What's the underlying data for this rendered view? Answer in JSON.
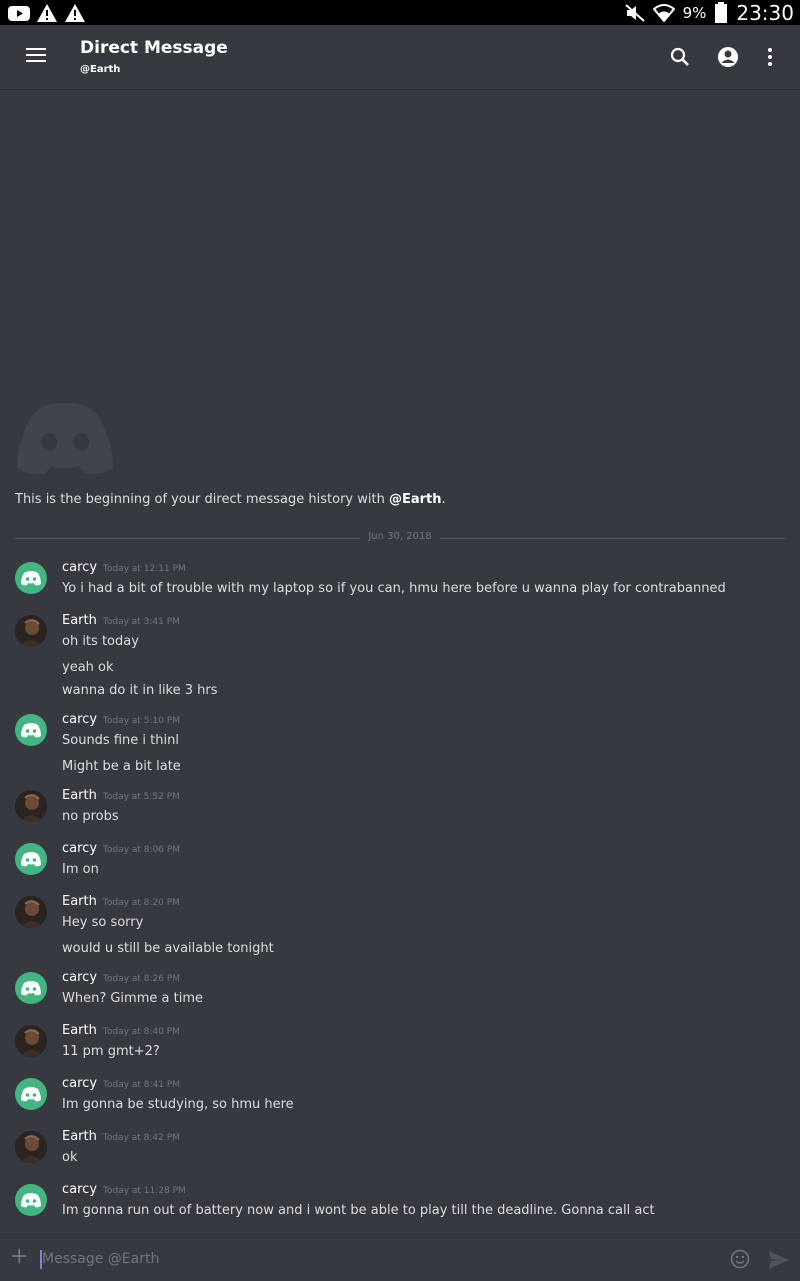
{
  "status_bar": {
    "icons": [
      "youtube-icon",
      "warning-icon",
      "warning-icon",
      "mute-icon",
      "wifi-icon",
      "battery-icon"
    ],
    "battery": "9%",
    "time": "23:30"
  },
  "header": {
    "title": "Direct Message",
    "subtitle": "@Earth",
    "icons": [
      "menu-icon",
      "search-icon",
      "account-icon",
      "more-icon"
    ]
  },
  "welcome": {
    "text_prefix": "This is the beginning of your direct message history with ",
    "mention": "@Earth",
    "text_suffix": "."
  },
  "divider_date": "Jun 30, 2018",
  "messages": [
    {
      "author": "carcy",
      "time": "Today at 12:11 PM",
      "lines": [
        "Yo i had a bit of trouble with my laptop so if you can, hmu here before u wanna play for contrabanned"
      ]
    },
    {
      "author": "Earth",
      "time": "Today at 3:41 PM",
      "lines": [
        "oh its today",
        "yeah ok",
        "wanna do it in like 3 hrs"
      ]
    },
    {
      "author": "carcy",
      "time": "Today at 5:10 PM",
      "lines": [
        "Sounds fine i thinl",
        "Might be a bit late"
      ]
    },
    {
      "author": "Earth",
      "time": "Today at 5:52 PM",
      "lines": [
        "no probs"
      ]
    },
    {
      "author": "carcy",
      "time": "Today at 8:06 PM",
      "lines": [
        "Im on"
      ]
    },
    {
      "author": "Earth",
      "time": "Today at 8:20 PM",
      "lines": [
        "Hey so sorry",
        "would u still be available tonight"
      ]
    },
    {
      "author": "carcy",
      "time": "Today at 8:26 PM",
      "lines": [
        "When? Gimme a time"
      ]
    },
    {
      "author": "Earth",
      "time": "Today at 8:40 PM",
      "lines": [
        "11 pm gmt+2?"
      ]
    },
    {
      "author": "carcy",
      "time": "Today at 8:41 PM",
      "lines": [
        "Im gonna be studying, so hmu here"
      ]
    },
    {
      "author": "Earth",
      "time": "Today at 8:42 PM",
      "lines": [
        "ok"
      ]
    },
    {
      "author": "carcy",
      "time": "Today at 11:28 PM",
      "lines": [
        "Im gonna run out of battery now and i wont be able to play till the deadline. Gonna call act"
      ]
    }
  ],
  "composer": {
    "placeholder": "Message @Earth",
    "icons": [
      "plus-icon",
      "emoji-icon",
      "send-icon"
    ]
  },
  "colors": {
    "background": "#36393f",
    "discord_green": "#43b581",
    "accent": "#7289da",
    "muted": "#72767d"
  }
}
